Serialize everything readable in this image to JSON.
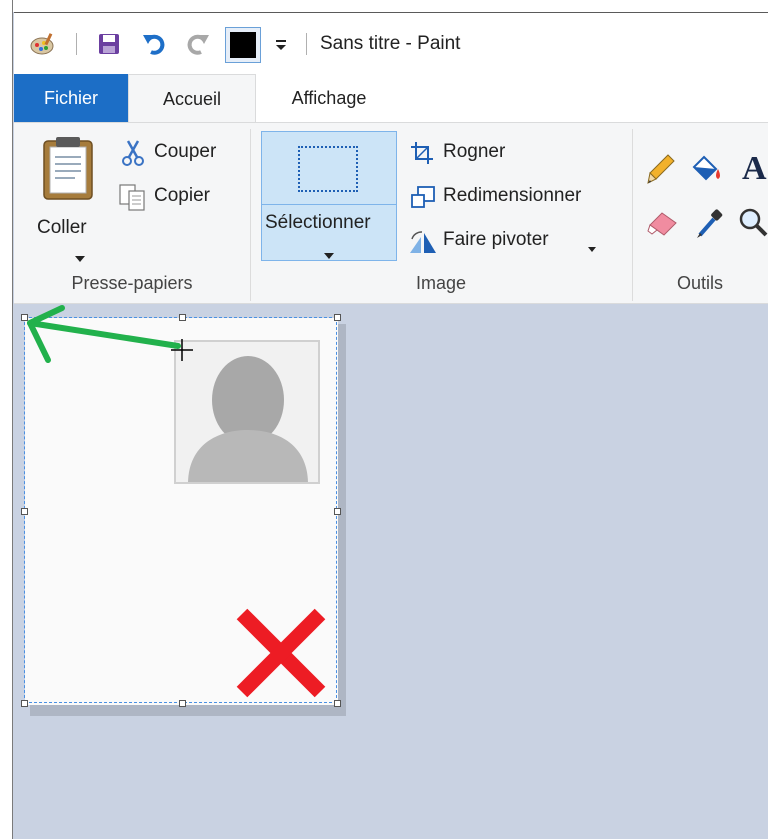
{
  "window": {
    "title": "Sans titre - Paint"
  },
  "quick_access": {
    "icons": [
      "paint-app-icon",
      "save-icon",
      "undo-icon",
      "redo-icon",
      "color-swatch-icon",
      "customize-dropdown-icon"
    ],
    "current_color": "#000000"
  },
  "tabs": {
    "file": "Fichier",
    "home": "Accueil",
    "view": "Affichage"
  },
  "ribbon": {
    "clipboard": {
      "paste": "Coller",
      "cut": "Couper",
      "copy": "Copier",
      "label": "Presse-papiers"
    },
    "image": {
      "select": "Sélectionner",
      "crop": "Rogner",
      "resize": "Redimensionner",
      "rotate": "Faire pivoter",
      "label": "Image"
    },
    "tools": {
      "label": "Outils",
      "icons": [
        "pencil-icon",
        "fill-icon",
        "text-icon",
        "eraser-icon",
        "color-picker-icon",
        "magnifier-icon"
      ],
      "text_glyph": "A"
    }
  },
  "colors": {
    "file_tab": "#1c6ec6",
    "selection_fill": "#cce4f7",
    "workspace": "#c9d2e2",
    "annotation_arrow": "#22b14c",
    "annotation_x": "#ed1c24"
  }
}
